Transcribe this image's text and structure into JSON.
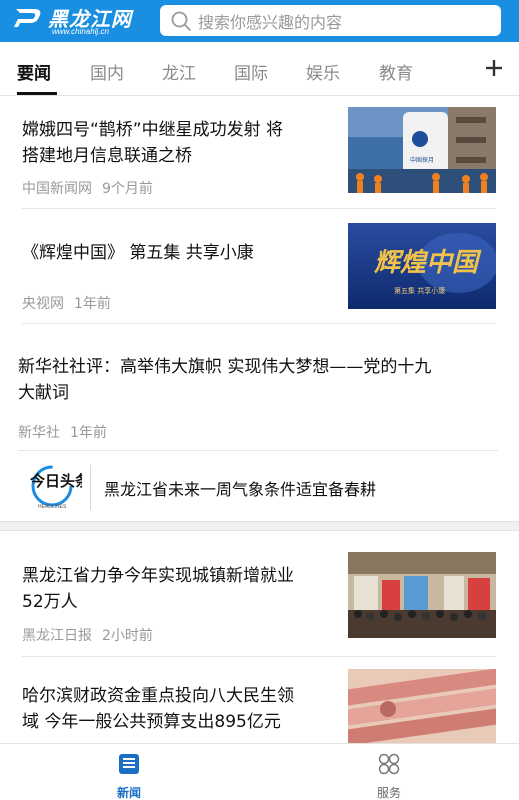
{
  "header": {
    "logo_text": "黑龙江网",
    "logo_url_text": "www.chinahlj.cn",
    "search_placeholder": "搜索你感兴趣的内容",
    "brand_color": "#1a8ee0"
  },
  "tabs": [
    {
      "label": "要闻",
      "active": true
    },
    {
      "label": "国内",
      "active": false
    },
    {
      "label": "龙江",
      "active": false
    },
    {
      "label": "国际",
      "active": false
    },
    {
      "label": "娱乐",
      "active": false
    },
    {
      "label": "教育",
      "active": false
    }
  ],
  "add_tab_icon": "plus-icon",
  "feed": [
    {
      "title_line1": "嫦娥四号“鹊桥”中继星成功发射 将",
      "title_line2": "搭建地月信息联通之桥",
      "source": "中国新闻网",
      "time": "9个月前",
      "thumb": "rocket-photo",
      "thumb_text": "中国探月"
    },
    {
      "title_line1": "《辉煌中国》 第五集 共享小康",
      "title_line2": "",
      "source": "央视网",
      "time": "1年前",
      "thumb": "brilliant-china-poster",
      "thumb_title": "辉煌中国",
      "thumb_sub": "第五集 共享小康"
    },
    {
      "title_line1": "新华社社评：高举伟大旗帜 实现伟大梦想——党的十九",
      "title_line2": "大献词",
      "source": "新华社",
      "time": "1年前"
    },
    {
      "headline_logo_text": "今日头条",
      "headline_logo_en": "HEADLINES",
      "title": "黑龙江省未来一周气象条件适宜备春耕"
    },
    {
      "title_line1": "黑龙江省力争今年实现城镇新增就业",
      "title_line2": "52万人",
      "source": "黑龙江日报",
      "time": "2小时前",
      "thumb": "job-fair-photo"
    },
    {
      "title_line1": "哈尔滨财政资金重点投向八大民生领",
      "title_line2": "域 今年一般公共预算支出895亿元",
      "source": "",
      "time": "",
      "thumb": "banknotes-photo"
    }
  ],
  "bottom_nav": [
    {
      "label": "新闻",
      "icon": "news-icon",
      "active": true
    },
    {
      "label": "服务",
      "icon": "services-icon",
      "active": false
    }
  ]
}
